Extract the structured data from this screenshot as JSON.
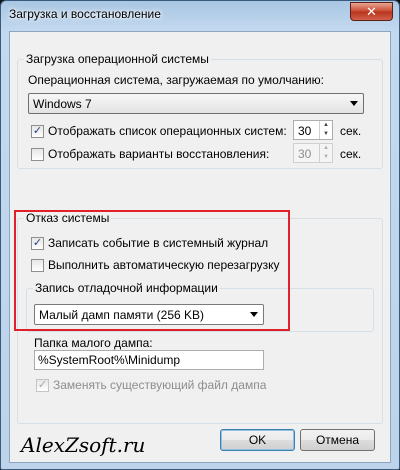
{
  "window": {
    "title": "Загрузка и восстановление",
    "close_glyph": "✕"
  },
  "startup": {
    "group_title": "Загрузка операционной системы",
    "default_os_label": "Операционная система, загружаемая по умолчанию:",
    "default_os_value": "Windows 7",
    "show_list": {
      "label": "Отображать список операционных систем:",
      "checked": true,
      "value": "30",
      "unit": "сек."
    },
    "show_recovery": {
      "label": "Отображать варианты восстановления:",
      "checked": false,
      "value": "30",
      "unit": "сек."
    }
  },
  "failure": {
    "group_title": "Отказ системы",
    "write_event": {
      "label": "Записать событие в системный журнал",
      "checked": true
    },
    "auto_restart": {
      "label": "Выполнить автоматическую перезагрузку",
      "checked": false
    }
  },
  "debug": {
    "group_title": "Запись отладочной информации",
    "dump_type_value": "Малый дамп памяти (256 KB)",
    "dump_folder_label": "Папка малого дампа:",
    "dump_folder_value": "%SystemRoot%\\Minidump",
    "overwrite": {
      "label": "Заменять существующий файл дампа",
      "checked": true
    }
  },
  "buttons": {
    "ok": "OK",
    "cancel": "Отмена"
  },
  "watermark": "AlexZsoft.ru",
  "icons": {
    "check": "✓",
    "spin_up": "▲",
    "spin_down": "▼"
  },
  "colors": {
    "highlight": "#e0202a"
  }
}
